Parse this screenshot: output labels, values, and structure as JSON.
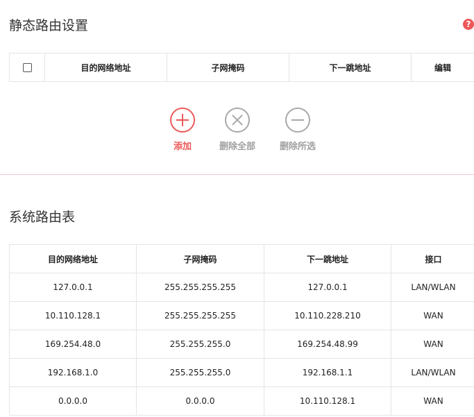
{
  "static_routes": {
    "title": "静态路由设置",
    "help_icon": "?",
    "columns": [
      "目的网络地址",
      "子网掩码",
      "下一跳地址",
      "编辑"
    ]
  },
  "actions": {
    "add": {
      "label": "添加",
      "icon": "plus-circle-icon",
      "color": "#ee5858"
    },
    "delete_all": {
      "label": "删除全部",
      "icon": "close-circle-icon",
      "color": "#a0a0a0"
    },
    "delete_selected": {
      "label": "删除所选",
      "icon": "minus-circle-icon",
      "color": "#a0a0a0"
    }
  },
  "system_routes": {
    "title": "系统路由表",
    "columns": [
      "目的网络地址",
      "子网掩码",
      "下一跳地址",
      "接口"
    ],
    "rows": [
      [
        "127.0.0.1",
        "255.255.255.255",
        "127.0.0.1",
        "LAN/WLAN"
      ],
      [
        "10.110.128.1",
        "255.255.255.255",
        "10.110.228.210",
        "WAN"
      ],
      [
        "169.254.48.0",
        "255.255.255.0",
        "169.254.48.99",
        "WAN"
      ],
      [
        "192.168.1.0",
        "255.255.255.0",
        "192.168.1.1",
        "LAN/WLAN"
      ],
      [
        "0.0.0.0",
        "0.0.0.0",
        "10.110.128.1",
        "WAN"
      ]
    ]
  }
}
